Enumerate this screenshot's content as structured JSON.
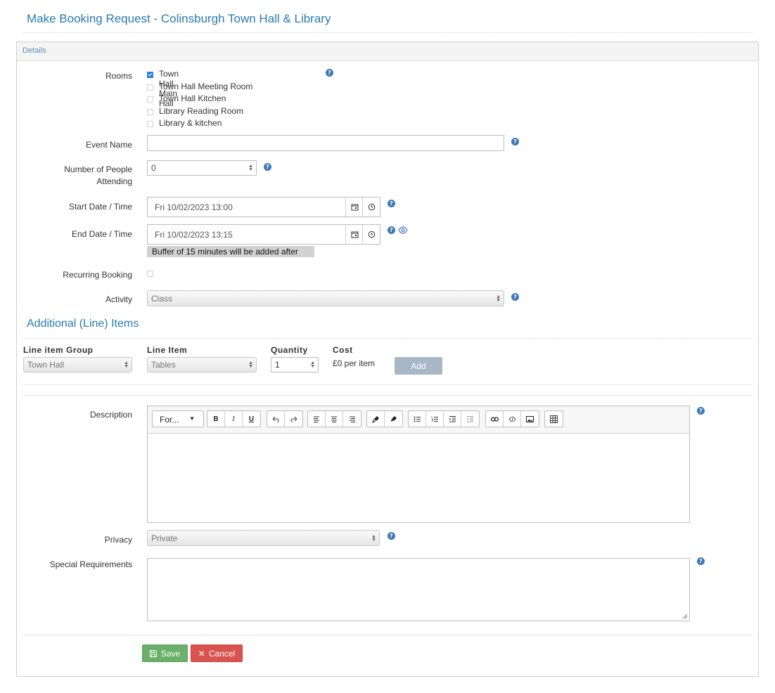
{
  "page": {
    "title": "Make Booking Request - Colinsburgh Town Hall & Library"
  },
  "panel": {
    "heading": "Details"
  },
  "rooms": {
    "label": "Rooms",
    "items": [
      {
        "label": "Town Hall Main Hall",
        "checked": true
      },
      {
        "label": "Town Hall Meeting Room",
        "checked": false
      },
      {
        "label": "Town Hall Kitchen",
        "checked": false
      },
      {
        "label": "Library Reading Room",
        "checked": false
      },
      {
        "label": "Library & kitchen",
        "checked": false
      }
    ]
  },
  "event_name": {
    "label": "Event Name",
    "value": ""
  },
  "people": {
    "label_line1": "Number of People",
    "label_line2": "Attending",
    "value": "0"
  },
  "start": {
    "label": "Start Date / Time",
    "value": "Fri 10/02/2023 13:00"
  },
  "end": {
    "label": "End Date / Time",
    "value": "Fri 10/02/2023 13:15",
    "buffer_note": "Buffer of 15 minutes will be added after"
  },
  "recurring": {
    "label": "Recurring Booking",
    "checked": false
  },
  "activity": {
    "label": "Activity",
    "value": "Class"
  },
  "line_items": {
    "title": "Additional (Line) Items",
    "headers": {
      "group": "Line item Group",
      "item": "Line Item",
      "quantity": "Quantity",
      "cost": "Cost"
    },
    "group_value": "Town Hall",
    "item_value": "Tables",
    "quantity_value": "1",
    "cost_value": "£0 per item",
    "add_label": "Add"
  },
  "description": {
    "label": "Description",
    "format_label": "For...",
    "toolbar": {
      "bold": "B",
      "italic": "I",
      "underline": "U"
    }
  },
  "privacy": {
    "label": "Privacy",
    "value": "Private"
  },
  "special": {
    "label": "Special Requirements",
    "value": ""
  },
  "actions": {
    "save": "Save",
    "cancel": "Cancel"
  },
  "colors": {
    "accent": "#2a7ab0",
    "help": "#3e79b5",
    "save": "#6ab06a",
    "cancel": "#d9534f",
    "add": "#a8b7c6"
  },
  "icons": {
    "help": "question-circle-icon",
    "calendar": "calendar-icon",
    "clock": "clock-icon",
    "eye": "eye-icon",
    "save": "floppy-icon",
    "cancel": "x-icon"
  }
}
